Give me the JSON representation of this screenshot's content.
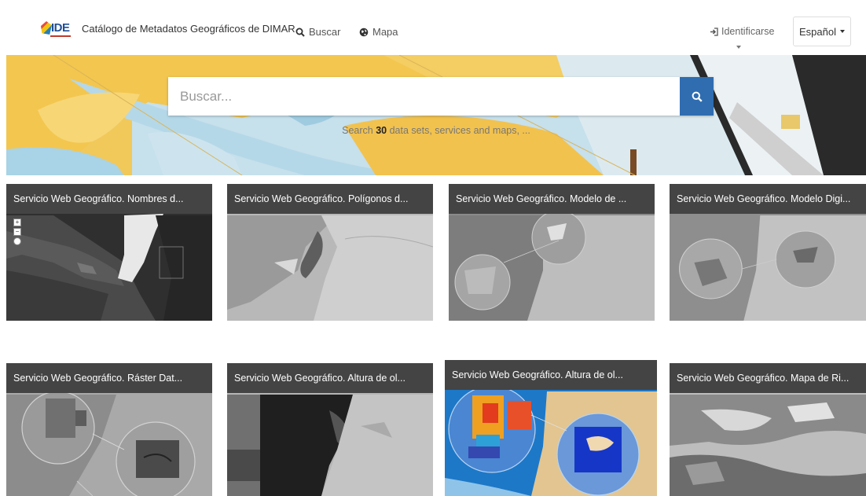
{
  "header": {
    "logo_text": "IDE",
    "title": "Catálogo de Metadatos Geográficos de DIMAR",
    "nav": [
      {
        "label": "Buscar",
        "icon": "search-icon"
      },
      {
        "label": "Mapa",
        "icon": "globe-icon"
      }
    ],
    "login_label": "Identificarse",
    "language_label": "Español"
  },
  "search": {
    "placeholder": "Buscar...",
    "subtitle_prefix": "Search ",
    "count": "30",
    "subtitle_suffix": " data sets, services and maps, ..."
  },
  "cards": [
    {
      "title": "Servicio Web Geográfico. Nombres d..."
    },
    {
      "title": "Servicio Web Geográfico. Polígonos d..."
    },
    {
      "title": "Servicio Web Geográfico. Modelo de ..."
    },
    {
      "title": "Servicio Web Geográfico. Modelo Digi..."
    },
    {
      "title": "Servicio Web Geográfico. Ráster Dat..."
    },
    {
      "title": "Servicio Web Geográfico. Altura de ol..."
    },
    {
      "title": "Servicio Web Geográfico. Altura de ol..."
    },
    {
      "title": "Servicio Web Geográfico. Mapa de Ri..."
    }
  ],
  "colors": {
    "accent": "#2f6db0",
    "card_header": "#444444",
    "map_sand": "#f2c24e",
    "map_water": "#b9dcea"
  }
}
